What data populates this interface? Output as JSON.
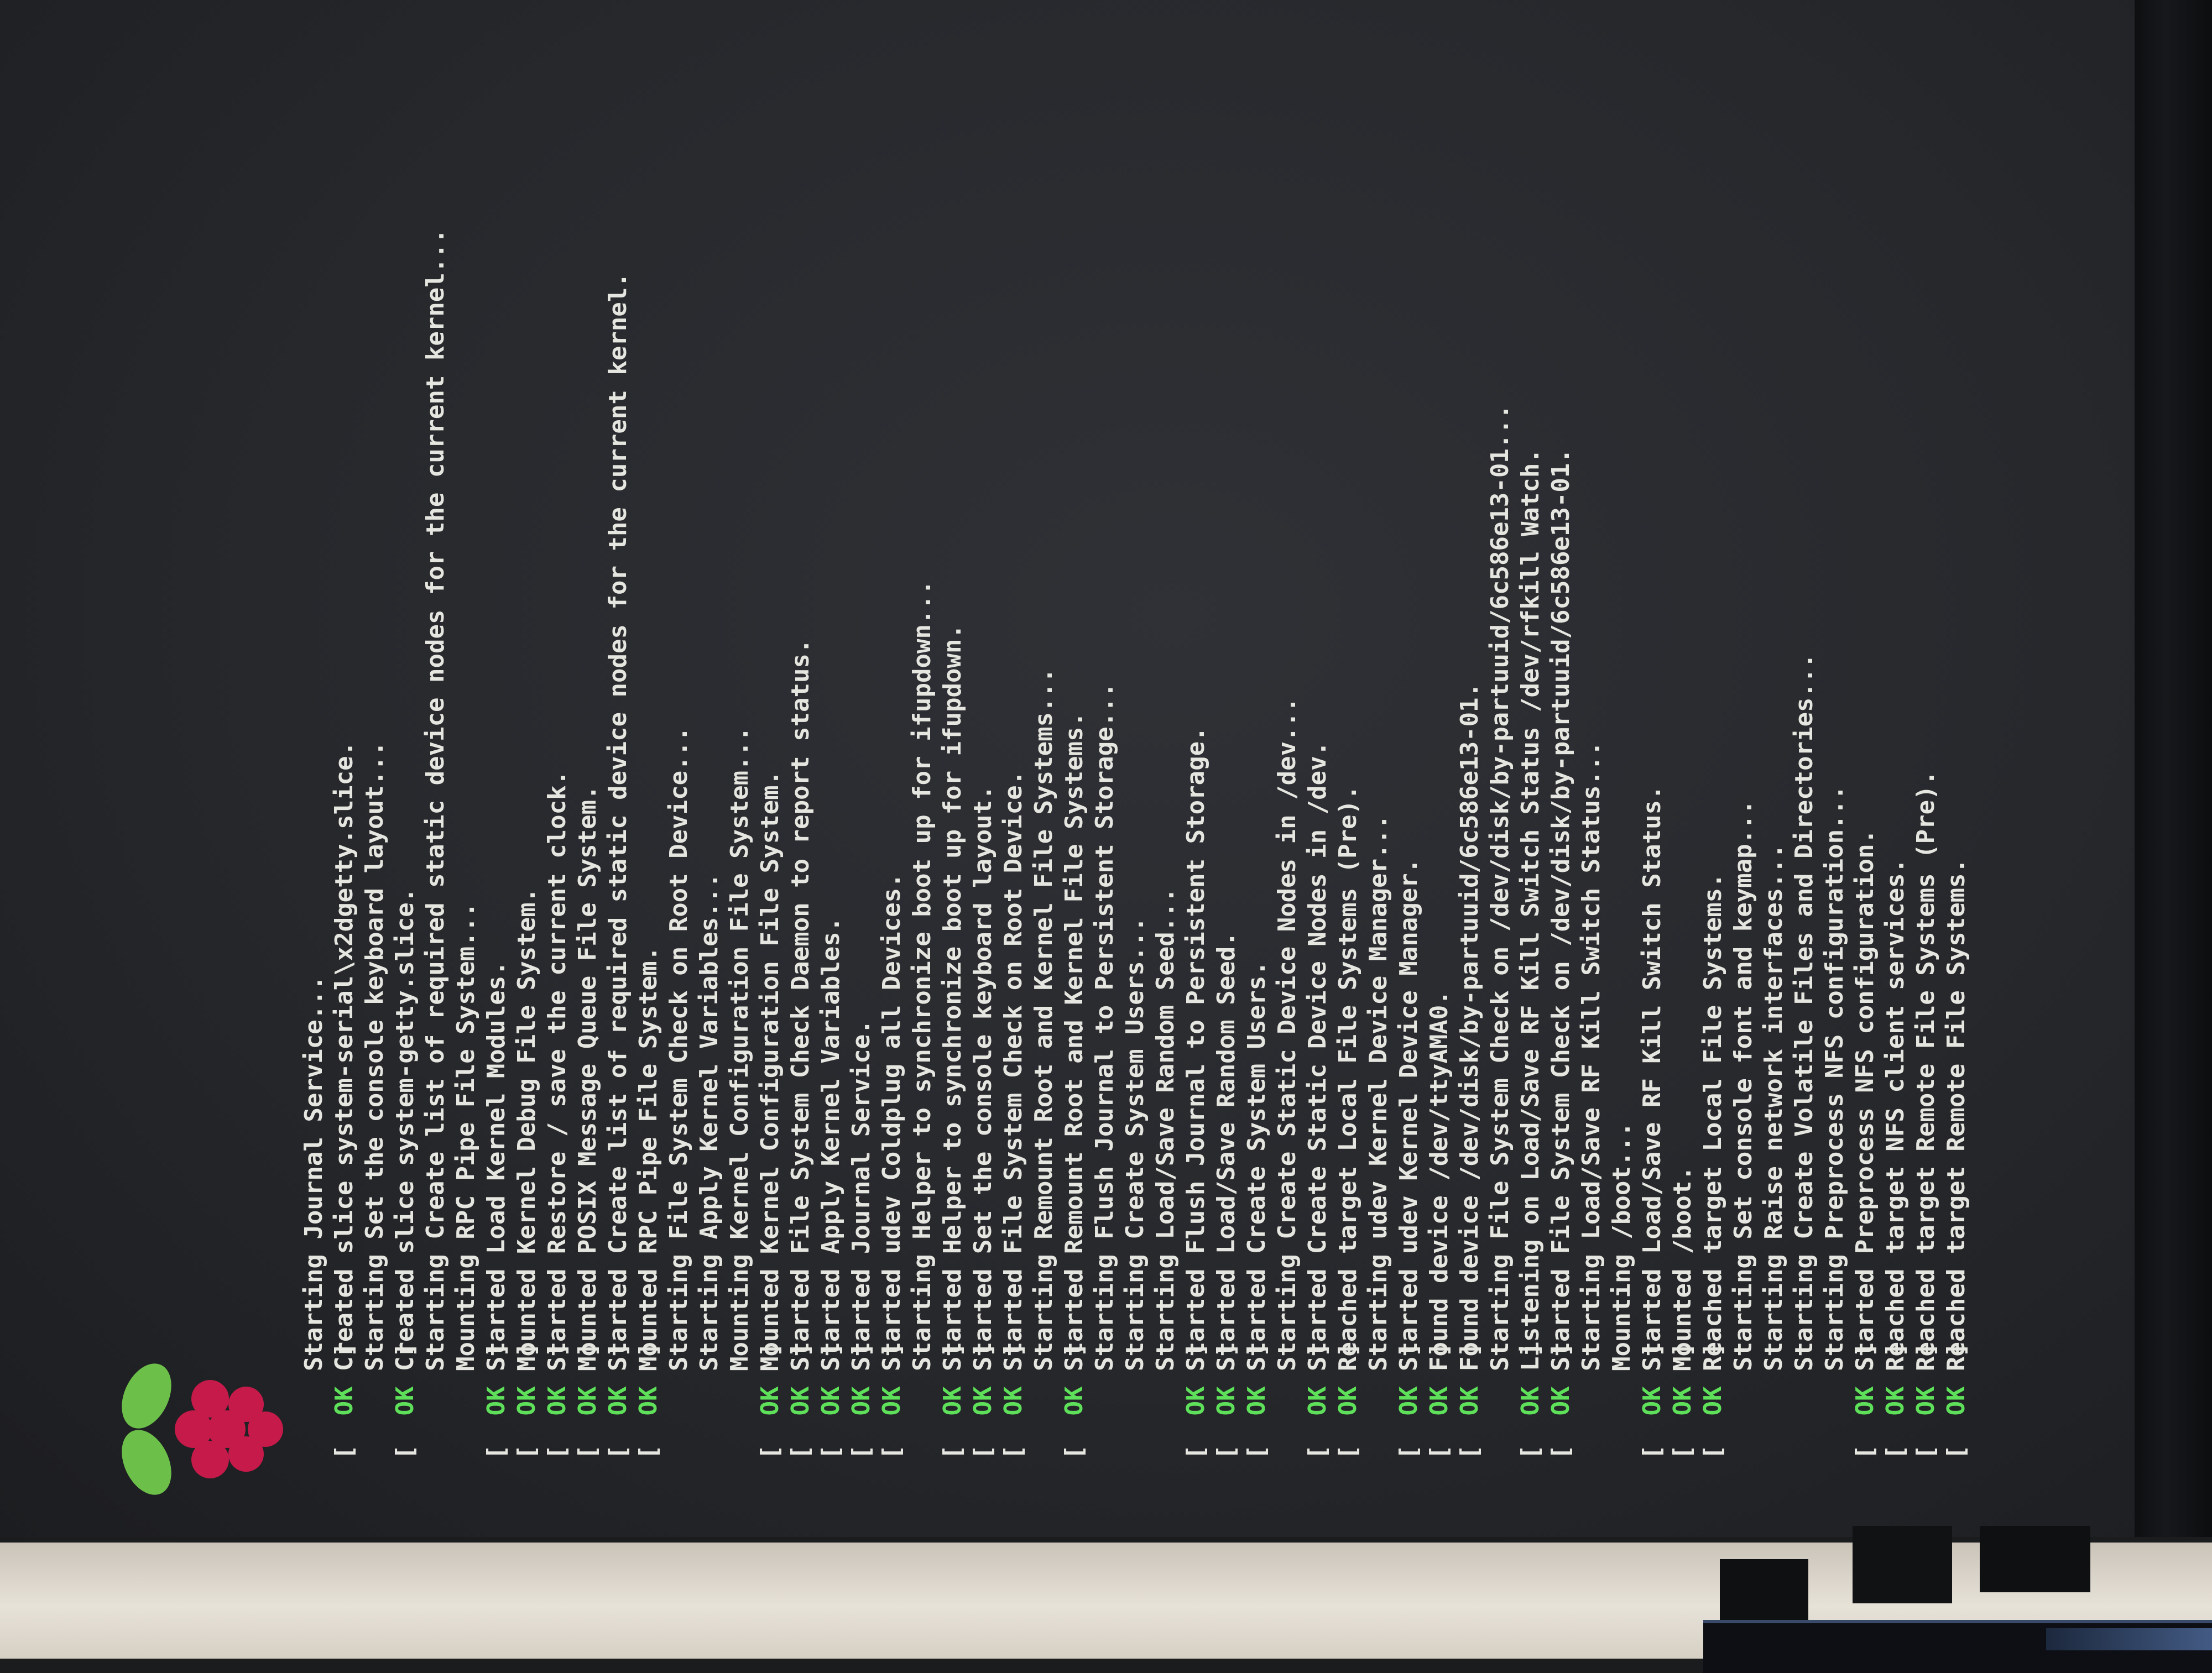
{
  "logo": {
    "icon": "raspberry-pi-logo-icon",
    "berry_color": "#c51a4a",
    "leaf_color": "#6cc04a"
  },
  "colors": {
    "ok": "#5fe05a",
    "text": "#e6e6e0",
    "screen": "#26282c"
  },
  "boot_log": [
    {
      "status": "",
      "text": "Starting Journal Service..."
    },
    {
      "status": "OK",
      "text": "Created slice system-serial\\x2dgetty.slice."
    },
    {
      "status": "",
      "text": "Starting Set the console keyboard layout..."
    },
    {
      "status": "OK",
      "text": "Created slice system-getty.slice."
    },
    {
      "status": "",
      "text": "Starting Create list of required static device nodes for the current kernel..."
    },
    {
      "status": "",
      "text": "Mounting RPC Pipe File System..."
    },
    {
      "status": "OK",
      "text": "Started Load Kernel Modules."
    },
    {
      "status": "OK",
      "text": "Mounted Kernel Debug File System."
    },
    {
      "status": "OK",
      "text": "Started Restore / save the current clock."
    },
    {
      "status": "OK",
      "text": "Mounted POSIX Message Queue File System."
    },
    {
      "status": "OK",
      "text": "Started Create list of required static device nodes for the current kernel."
    },
    {
      "status": "OK",
      "text": "Mounted RPC Pipe File System."
    },
    {
      "status": "",
      "text": "Starting File System Check on Root Device..."
    },
    {
      "status": "",
      "text": "Starting Apply Kernel Variables..."
    },
    {
      "status": "",
      "text": "Mounting Kernel Configuration File System..."
    },
    {
      "status": "OK",
      "text": "Mounted Kernel Configuration File System."
    },
    {
      "status": "OK",
      "text": "Started File System Check Daemon to report status."
    },
    {
      "status": "OK",
      "text": "Started Apply Kernel Variables."
    },
    {
      "status": "OK",
      "text": "Started Journal Service."
    },
    {
      "status": "OK",
      "text": "Started udev Coldplug all Devices."
    },
    {
      "status": "",
      "text": "Starting Helper to synchronize boot up for ifupdown..."
    },
    {
      "status": "OK",
      "text": "Started Helper to synchronize boot up for ifupdown."
    },
    {
      "status": "OK",
      "text": "Started Set the console keyboard layout."
    },
    {
      "status": "OK",
      "text": "Started File System Check on Root Device."
    },
    {
      "status": "",
      "text": "Starting Remount Root and Kernel File Systems..."
    },
    {
      "status": "OK",
      "text": "Started Remount Root and Kernel File Systems."
    },
    {
      "status": "",
      "text": "Starting Flush Journal to Persistent Storage..."
    },
    {
      "status": "",
      "text": "Starting Create System Users..."
    },
    {
      "status": "",
      "text": "Starting Load/Save Random Seed..."
    },
    {
      "status": "OK",
      "text": "Started Flush Journal to Persistent Storage."
    },
    {
      "status": "OK",
      "text": "Started Load/Save Random Seed."
    },
    {
      "status": "OK",
      "text": "Started Create System Users."
    },
    {
      "status": "",
      "text": "Starting Create Static Device Nodes in /dev..."
    },
    {
      "status": "OK",
      "text": "Started Create Static Device Nodes in /dev."
    },
    {
      "status": "OK",
      "text": "Reached target Local File Systems (Pre)."
    },
    {
      "status": "",
      "text": "Starting udev Kernel Device Manager..."
    },
    {
      "status": "OK",
      "text": "Started udev Kernel Device Manager."
    },
    {
      "status": "OK",
      "text": "Found device /dev/ttyAMA0."
    },
    {
      "status": "OK",
      "text": "Found device /dev/disk/by-partuuid/6c586e13-01."
    },
    {
      "status": "",
      "text": "Starting File System Check on /dev/disk/by-partuuid/6c586e13-01..."
    },
    {
      "status": "OK",
      "text": "Listening on Load/Save RF Kill Switch Status /dev/rfkill Watch."
    },
    {
      "status": "OK",
      "text": "Started File System Check on /dev/disk/by-partuuid/6c586e13-01."
    },
    {
      "status": "",
      "text": "Starting Load/Save RF Kill Switch Status..."
    },
    {
      "status": "",
      "text": "Mounting /boot..."
    },
    {
      "status": "OK",
      "text": "Started Load/Save RF Kill Switch Status."
    },
    {
      "status": "OK",
      "text": "Mounted /boot."
    },
    {
      "status": "OK",
      "text": "Reached target Local File Systems."
    },
    {
      "status": "",
      "text": "Starting Set console font and keymap..."
    },
    {
      "status": "",
      "text": "Starting Raise network interfaces..."
    },
    {
      "status": "",
      "text": "Starting Create Volatile Files and Directories..."
    },
    {
      "status": "",
      "text": "Starting Preprocess NFS configuration..."
    },
    {
      "status": "OK",
      "text": "Started Preprocess NFS configuration."
    },
    {
      "status": "OK",
      "text": "Reached target NFS client services."
    },
    {
      "status": "OK",
      "text": "Reached target Remote File Systems (Pre)."
    },
    {
      "status": "OK",
      "text": "Reached target Remote File Systems."
    }
  ]
}
